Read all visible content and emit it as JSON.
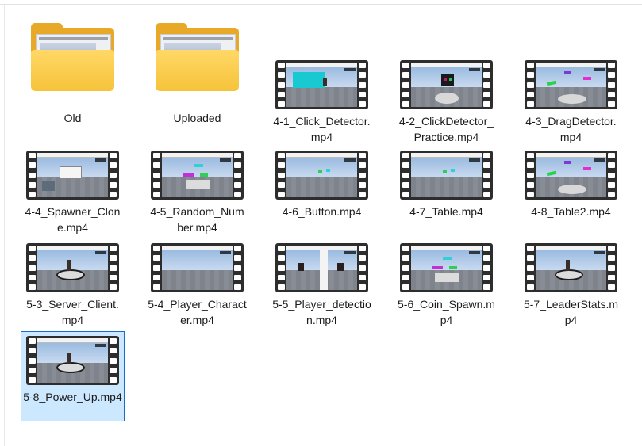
{
  "explorer": {
    "selected_index": 17,
    "items": [
      {
        "type": "folder",
        "name": "Old"
      },
      {
        "type": "folder",
        "name": "Uploaded"
      },
      {
        "type": "video",
        "name": "4-1_Click_Detector.mp4",
        "scene": "cyan-wall"
      },
      {
        "type": "video",
        "name": "4-2_ClickDetector_Practice.mp4",
        "scene": "cube-pattern"
      },
      {
        "type": "video",
        "name": "4-3_DragDetector.mp4",
        "scene": "colored-parts"
      },
      {
        "type": "video",
        "name": "4-4_Spawner_Clone.mp4",
        "scene": "dialog"
      },
      {
        "type": "video",
        "name": "4-5_Random_Number.mp4",
        "scene": "platform"
      },
      {
        "type": "video",
        "name": "4-6_Button.mp4",
        "scene": "small-parts"
      },
      {
        "type": "video",
        "name": "4-7_Table.mp4",
        "scene": "small-parts"
      },
      {
        "type": "video",
        "name": "4-8_Table2.mp4",
        "scene": "colored-parts"
      },
      {
        "type": "video",
        "name": "5-3_Server_Client.mp4",
        "scene": "avatar-pattern"
      },
      {
        "type": "video",
        "name": "5-4_Player_Character.mp4",
        "scene": "empty"
      },
      {
        "type": "video",
        "name": "5-5_Player_detection.mp4",
        "scene": "split"
      },
      {
        "type": "video",
        "name": "5-6_Coin_Spawn.mp4",
        "scene": "platform"
      },
      {
        "type": "video",
        "name": "5-7_LeaderStats.mp4",
        "scene": "avatar-pattern"
      },
      {
        "type": "video",
        "name": "5-8_Power_Up.mp4",
        "scene": "avatar-pattern"
      }
    ]
  },
  "colors": {
    "folder": "#f6c33a",
    "selection_bg": "#cce8ff",
    "selection_border": "#1b6ac9",
    "film": "#2d2d2d"
  }
}
